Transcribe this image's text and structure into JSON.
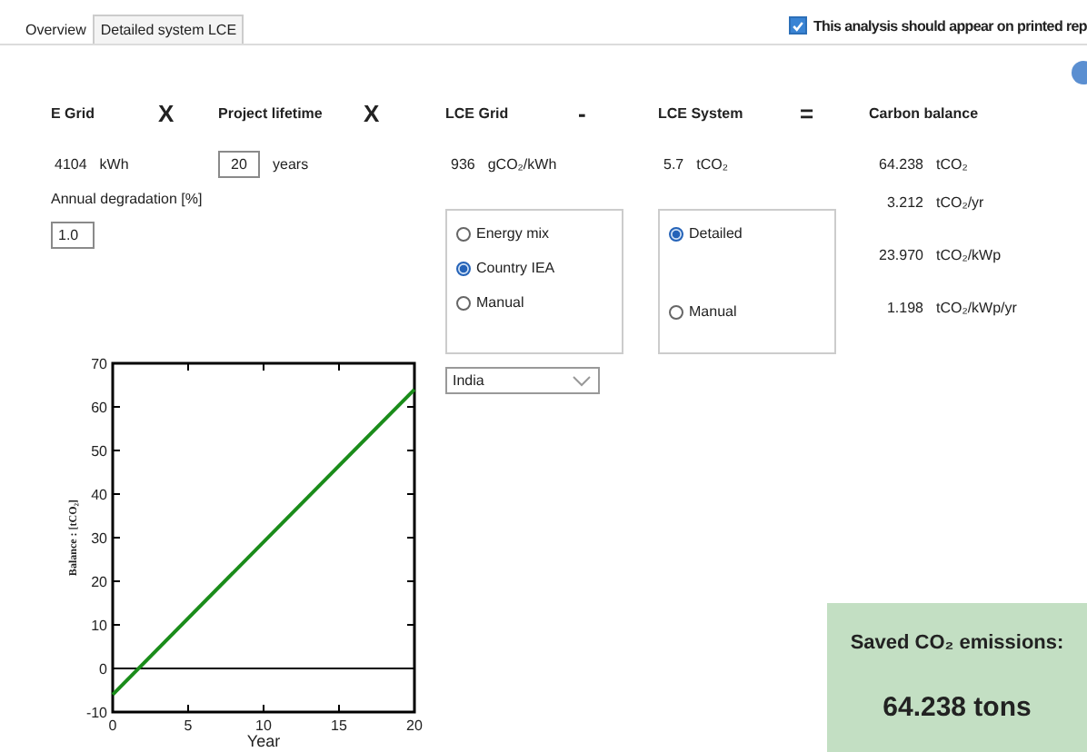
{
  "tabs": [
    {
      "label": "Overview",
      "selected": false
    },
    {
      "label": "Detailed system LCE",
      "selected": true
    }
  ],
  "print_option": {
    "label": "This analysis should appear on printed rep",
    "checked": true
  },
  "e_grid": {
    "title": "E Grid",
    "value": "4104",
    "unit": "kWh",
    "degradation_label": "Annual degradation [%]",
    "degradation_value": "1.0"
  },
  "operators": [
    "X",
    "X",
    "-",
    "="
  ],
  "project_lifetime": {
    "title": "Project lifetime",
    "value": "20",
    "unit": "years"
  },
  "lce_grid": {
    "title": "LCE Grid",
    "value": "936",
    "unit": "gCO₂/kWh",
    "options": [
      {
        "label": "Energy mix",
        "selected": false
      },
      {
        "label": "Country IEA",
        "selected": true
      },
      {
        "label": "Manual",
        "selected": false
      }
    ],
    "country": "India"
  },
  "lce_system": {
    "title": "LCE System",
    "value": "5.7",
    "unit": "tCO₂",
    "options": [
      {
        "label": "Detailed",
        "selected": true
      },
      {
        "label": "Manual",
        "selected": false
      }
    ]
  },
  "carbon_balance": {
    "title": "Carbon balance",
    "rows": [
      {
        "value": "64.238",
        "unit": "tCO₂"
      },
      {
        "value": "3.212",
        "unit": "tCO₂/yr"
      },
      {
        "value": "23.970",
        "unit": "tCO₂/kWp"
      },
      {
        "value": "1.198",
        "unit": "tCO₂/kWp/yr"
      }
    ]
  },
  "chart_data": {
    "type": "line",
    "xlabel": "Year",
    "ylabel": "Balance : [tCO₂]",
    "x": [
      0,
      20
    ],
    "series": [
      {
        "color": "#1a8c1a",
        "values": [
          -6,
          64
        ]
      }
    ],
    "xlim": [
      0,
      20
    ],
    "ylim": [
      -10,
      70
    ],
    "xticks": [
      0,
      5,
      10,
      15,
      20
    ],
    "yticks": [
      -10,
      0,
      10,
      20,
      30,
      40,
      50,
      60,
      70
    ]
  },
  "summary": {
    "title": "Saved CO₂ emissions:",
    "value": "64.238 tons"
  }
}
